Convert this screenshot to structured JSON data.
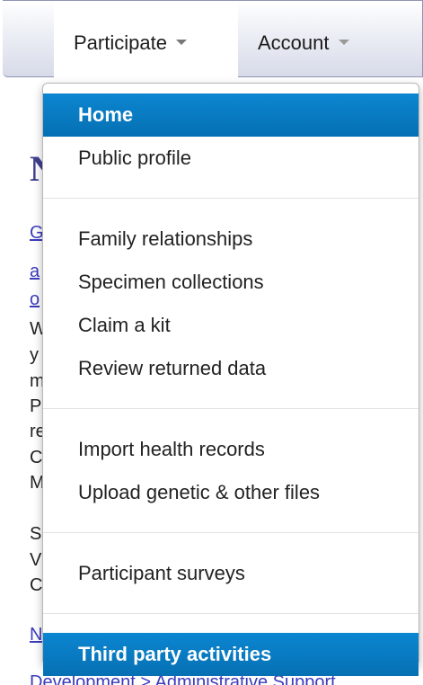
{
  "navbar": {
    "tabs": [
      {
        "label": "Participate",
        "active": true
      },
      {
        "label": "Account",
        "active": false
      }
    ]
  },
  "background": {
    "heading": "N",
    "lines": [
      "G",
      "a",
      "o",
      "W",
      "y",
      "m",
      "P",
      "re",
      "C",
      "M",
      "S",
      "V",
      "C"
    ],
    "footer": "Development > Administrative Support",
    "footer_link": "N"
  },
  "dropdown": {
    "groups": [
      [
        "Home",
        "Public profile"
      ],
      [
        "Family relationships",
        "Specimen collections",
        "Claim a kit",
        "Review returned data"
      ],
      [
        "Import health records",
        "Upload genetic & other files"
      ],
      [
        "Participant surveys"
      ],
      [
        "Third party activities"
      ]
    ],
    "highlighted": [
      "Home",
      "Third party activities"
    ],
    "highlight_color": "#0a7bc2"
  }
}
